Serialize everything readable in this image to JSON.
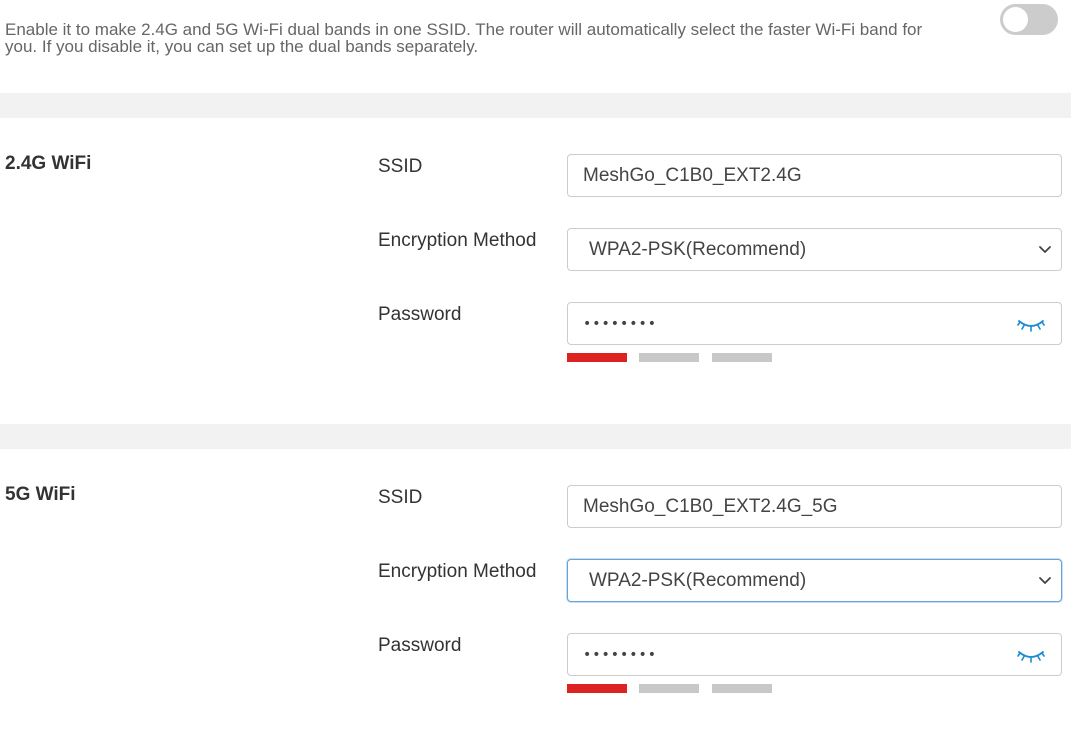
{
  "smart_connect": {
    "description": "Enable it to make 2.4G and 5G Wi-Fi dual bands in one SSID. The router will automatically select the faster Wi-Fi band for you. If you disable it, you can set up the dual bands separately.",
    "enabled": false
  },
  "wifi_24g": {
    "title": "2.4G WiFi",
    "ssid_label": "SSID",
    "ssid_value": "MeshGo_C1B0_EXT2.4G",
    "encryption_label": "Encryption Method",
    "encryption_value": "WPA2-PSK(Recommend)",
    "password_label": "Password",
    "password_masked": "••••••••",
    "password_strength": 1,
    "password_strength_max": 3
  },
  "wifi_5g": {
    "title": "5G WiFi",
    "ssid_label": "SSID",
    "ssid_value": "MeshGo_C1B0_EXT2.4G_5G",
    "encryption_label": "Encryption Method",
    "encryption_value": "WPA2-PSK(Recommend)",
    "password_label": "Password",
    "password_masked": "••••••••",
    "password_strength": 1,
    "password_strength_max": 3
  },
  "colors": {
    "strength_weak": "#dd2222",
    "strength_empty": "#c8c8c8",
    "eye_icon": "#1a8ad4",
    "toggle_off": "#cccccc",
    "band_bg": "#f2f2f2",
    "focus_border": "#66a3d9"
  },
  "icons": {
    "toggle": "toggle-switch-off",
    "select_arrow": "chevron-down-icon",
    "password_visibility": "eye-closed-icon"
  }
}
